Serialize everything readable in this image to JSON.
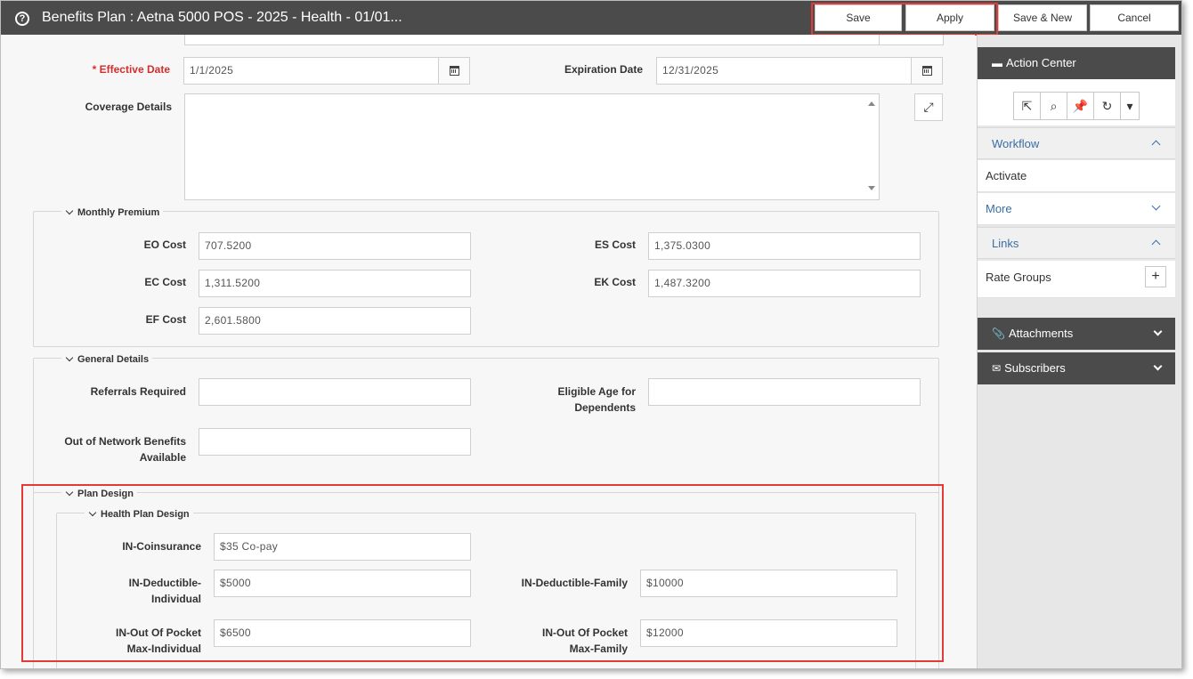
{
  "window": {
    "title": "Benefits Plan : Aetna 5000 POS - 2025 - Health - 01/01...",
    "help_icon": "?"
  },
  "toolbar": {
    "save_label": "Save",
    "apply_label": "Apply",
    "save_new_label": "Save & New",
    "cancel_label": "Cancel"
  },
  "form": {
    "effective_date_label": "* Effective Date",
    "effective_date_value": "1/1/2025",
    "expiration_date_label": "Expiration Date",
    "expiration_date_value": "12/31/2025",
    "coverage_details_label": "Coverage Details",
    "coverage_details_value": ""
  },
  "monthly_premium": {
    "title": "Monthly Premium",
    "eo_label": "EO Cost",
    "eo_value": "707.5200",
    "es_label": "ES Cost",
    "es_value": "1,375.0300",
    "ec_label": "EC Cost",
    "ec_value": "1,311.5200",
    "ek_label": "EK Cost",
    "ek_value": "1,487.3200",
    "ef_label": "EF Cost",
    "ef_value": "2,601.5800"
  },
  "general_details": {
    "title": "General Details",
    "referrals_label": "Referrals Required",
    "referrals_value": "",
    "eligible_age_label_1": "Eligible Age for",
    "eligible_age_label_2": "Dependents",
    "eligible_age_value": "",
    "oon_label_1": "Out of Network Benefits",
    "oon_label_2": "Available",
    "oon_value": ""
  },
  "plan_design": {
    "title": "Plan Design",
    "health_title": "Health Plan Design",
    "coinsurance_label": "IN-Coinsurance",
    "coinsurance_value": "$35 Co-pay",
    "ded_ind_label_1": "IN-Deductible-",
    "ded_ind_label_2": "Individual",
    "ded_ind_value": "$5000",
    "ded_fam_label": "IN-Deductible-Family",
    "ded_fam_value": "$10000",
    "oop_ind_label_1": "IN-Out Of Pocket",
    "oop_ind_label_2": "Max-Individual",
    "oop_ind_value": "$6500",
    "oop_fam_label_1": "IN-Out Of Pocket",
    "oop_fam_label_2": "Max-Family",
    "oop_fam_value": "$12000"
  },
  "sidebar": {
    "action_center": "Action Center",
    "workflow": "Workflow",
    "activate": "Activate",
    "more": "More",
    "links": "Links",
    "rate_groups": "Rate Groups",
    "plus": "+",
    "attachments": "Attachments",
    "subscribers": "Subscribers"
  },
  "colors": {
    "titlebar": "#4b4b4b",
    "highlight": "#e53935",
    "required": "#d32f2f",
    "link": "#3a6ea5"
  }
}
